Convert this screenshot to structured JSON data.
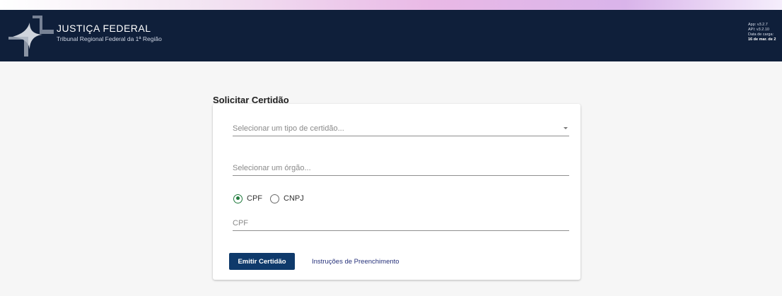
{
  "header": {
    "title": "JUSTIÇA FEDERAL",
    "subtitle": "Tribunal Regional Federal da 1ª Região",
    "version": {
      "app": "App: v3.2.7",
      "api": "API: v3.2.10",
      "data_label": "Data de carga:",
      "data_value": "16 de mar. de 2"
    }
  },
  "page": {
    "title": "Solicitar Certidão"
  },
  "form": {
    "tipo_placeholder": "Selecionar um tipo de certidão...",
    "orgao_placeholder": "Selecionar um órgão...",
    "radio_cpf": "CPF",
    "radio_cnpj": "CNPJ",
    "doc_placeholder": "CPF",
    "emit_label": "Emitir Certidão",
    "instr_label": "Instruções de Preenchimento"
  },
  "colors": {
    "header_bg": "#0f1f3a",
    "primary_button": "#0f3a6b",
    "radio_selected": "#1f7a3c"
  }
}
